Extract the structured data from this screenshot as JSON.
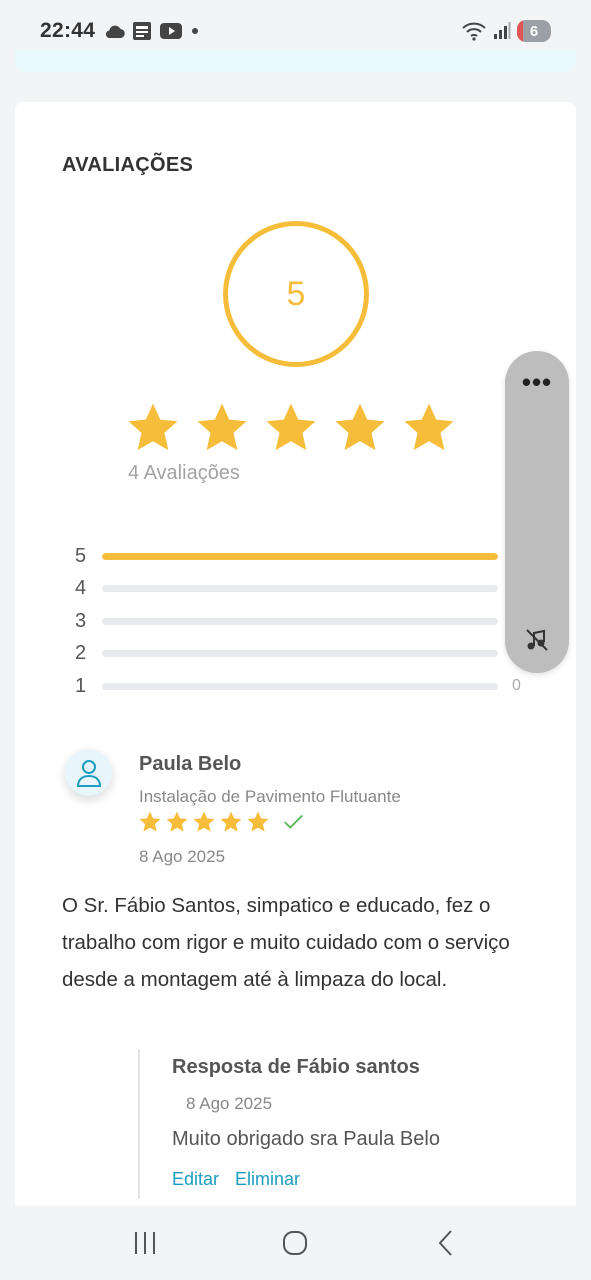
{
  "status_bar": {
    "time": "22:44",
    "left_icons": [
      "cloud-icon",
      "news-icon",
      "youtube-icon",
      "dot-icon"
    ],
    "right_icons": [
      "wifi-icon",
      "signal-icon"
    ],
    "battery": "6"
  },
  "ratings": {
    "section_title": "AVALIAÇÕES",
    "average": "5",
    "stars_filled": 5,
    "reviews_count_label": "4 Avaliações",
    "distribution": [
      {
        "label": "5",
        "fraction": 1.0,
        "count": ""
      },
      {
        "label": "4",
        "fraction": 0.0,
        "count": ""
      },
      {
        "label": "3",
        "fraction": 0.0,
        "count": ""
      },
      {
        "label": "2",
        "fraction": 0.0,
        "count": ""
      },
      {
        "label": "1",
        "fraction": 0.0,
        "count": "0"
      }
    ]
  },
  "review": {
    "name": "Paula Belo",
    "service": "Instalação de Pavimento Flutuante",
    "stars": 5,
    "verified_icon": "check-icon",
    "date": "8 Ago 2025",
    "text": "O Sr. Fábio Santos, simpatico e educado, fez o trabalho com rigor e muito cuidado com o serviço desde a montagem até à limpaza do local."
  },
  "reply": {
    "title": "Resposta de Fábio santos",
    "date": "8 Ago 2025",
    "text": "Muito obrigado sra Paula Belo",
    "edit_label": "Editar",
    "delete_label": "Eliminar"
  },
  "floating_panel": {
    "more_label": "•••",
    "mute_icon": "music-off-icon"
  },
  "colors": {
    "star": "#f6bd3b",
    "link": "#1a9cc0",
    "verified": "#5cb85c"
  }
}
